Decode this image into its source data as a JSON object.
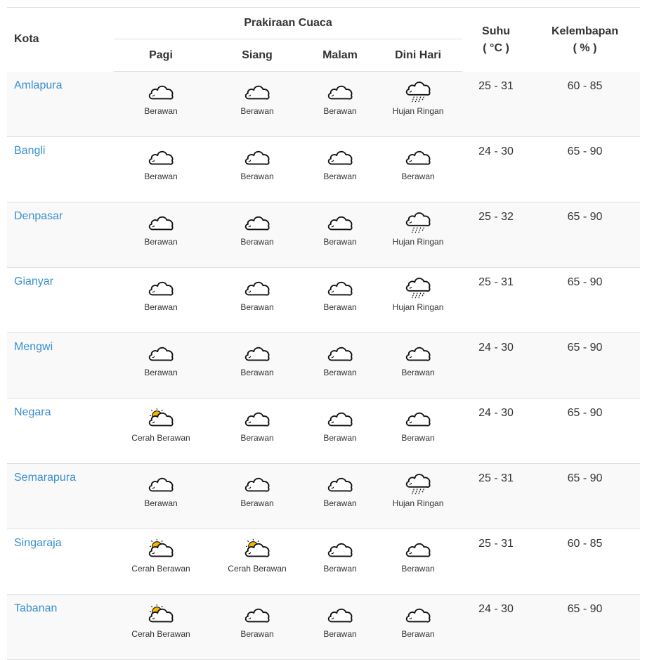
{
  "headers": {
    "kota": "Kota",
    "prakiraan": "Prakiraan Cuaca",
    "periods": [
      "Pagi",
      "Siang",
      "Malam",
      "Dini Hari"
    ],
    "suhu": "Suhu",
    "suhu_unit": "( °C )",
    "kelembapan": "Kelembapan",
    "kelembapan_unit": "( % )"
  },
  "rows": [
    {
      "city": "Amlapura",
      "forecast": [
        {
          "icon": "cloudy-icon",
          "label": "Berawan"
        },
        {
          "icon": "cloudy-icon",
          "label": "Berawan"
        },
        {
          "icon": "cloudy-icon",
          "label": "Berawan"
        },
        {
          "icon": "light-rain-icon",
          "label": "Hujan Ringan"
        }
      ],
      "suhu": "25 - 31",
      "kelembapan": "60 - 85"
    },
    {
      "city": "Bangli",
      "forecast": [
        {
          "icon": "cloudy-icon",
          "label": "Berawan"
        },
        {
          "icon": "cloudy-icon",
          "label": "Berawan"
        },
        {
          "icon": "cloudy-icon",
          "label": "Berawan"
        },
        {
          "icon": "cloudy-icon",
          "label": "Berawan"
        }
      ],
      "suhu": "24 - 30",
      "kelembapan": "65 - 90"
    },
    {
      "city": "Denpasar",
      "forecast": [
        {
          "icon": "cloudy-icon",
          "label": "Berawan"
        },
        {
          "icon": "cloudy-icon",
          "label": "Berawan"
        },
        {
          "icon": "cloudy-icon",
          "label": "Berawan"
        },
        {
          "icon": "light-rain-icon",
          "label": "Hujan Ringan"
        }
      ],
      "suhu": "25 - 32",
      "kelembapan": "65 - 90"
    },
    {
      "city": "Gianyar",
      "forecast": [
        {
          "icon": "cloudy-icon",
          "label": "Berawan"
        },
        {
          "icon": "cloudy-icon",
          "label": "Berawan"
        },
        {
          "icon": "cloudy-icon",
          "label": "Berawan"
        },
        {
          "icon": "light-rain-icon",
          "label": "Hujan Ringan"
        }
      ],
      "suhu": "25 - 31",
      "kelembapan": "65 - 90"
    },
    {
      "city": "Mengwi",
      "forecast": [
        {
          "icon": "cloudy-icon",
          "label": "Berawan"
        },
        {
          "icon": "cloudy-icon",
          "label": "Berawan"
        },
        {
          "icon": "cloudy-icon",
          "label": "Berawan"
        },
        {
          "icon": "cloudy-icon",
          "label": "Berawan"
        }
      ],
      "suhu": "24 - 30",
      "kelembapan": "65 - 90"
    },
    {
      "city": "Negara",
      "forecast": [
        {
          "icon": "partly-cloudy-icon",
          "label": "Cerah Berawan"
        },
        {
          "icon": "cloudy-icon",
          "label": "Berawan"
        },
        {
          "icon": "cloudy-icon",
          "label": "Berawan"
        },
        {
          "icon": "cloudy-icon",
          "label": "Berawan"
        }
      ],
      "suhu": "24 - 30",
      "kelembapan": "65 - 90"
    },
    {
      "city": "Semarapura",
      "forecast": [
        {
          "icon": "cloudy-icon",
          "label": "Berawan"
        },
        {
          "icon": "cloudy-icon",
          "label": "Berawan"
        },
        {
          "icon": "cloudy-icon",
          "label": "Berawan"
        },
        {
          "icon": "light-rain-icon",
          "label": "Hujan Ringan"
        }
      ],
      "suhu": "25 - 31",
      "kelembapan": "65 - 90"
    },
    {
      "city": "Singaraja",
      "forecast": [
        {
          "icon": "partly-cloudy-icon",
          "label": "Cerah Berawan"
        },
        {
          "icon": "partly-cloudy-icon",
          "label": "Cerah Berawan"
        },
        {
          "icon": "cloudy-icon",
          "label": "Berawan"
        },
        {
          "icon": "cloudy-icon",
          "label": "Berawan"
        }
      ],
      "suhu": "25 - 31",
      "kelembapan": "60 - 85"
    },
    {
      "city": "Tabanan",
      "forecast": [
        {
          "icon": "partly-cloudy-icon",
          "label": "Cerah Berawan"
        },
        {
          "icon": "cloudy-icon",
          "label": "Berawan"
        },
        {
          "icon": "cloudy-icon",
          "label": "Berawan"
        },
        {
          "icon": "cloudy-icon",
          "label": "Berawan"
        }
      ],
      "suhu": "24 - 30",
      "kelembapan": "65 - 90"
    }
  ],
  "colors": {
    "city_link": "#3a8fd0",
    "row_stripe": "#f9f9f9",
    "border": "#dddddd",
    "sun": "#f5b800"
  }
}
